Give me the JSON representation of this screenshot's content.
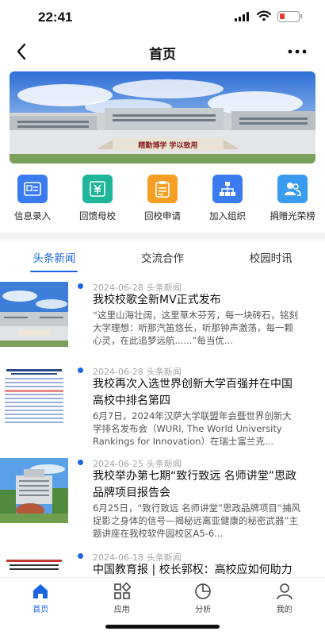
{
  "status_bar": {
    "time": "22:41"
  },
  "nav": {
    "title": "首页"
  },
  "banner": {
    "sign_text": "精勤博学 学以致用"
  },
  "actions": [
    {
      "label": "信息录入",
      "icon": "id-card-icon",
      "color": "#3a7cf0"
    },
    {
      "label": "回馈母校",
      "icon": "yuan-icon",
      "color": "#1fb59a"
    },
    {
      "label": "回校申请",
      "icon": "clipboard-icon",
      "color": "#f5a024"
    },
    {
      "label": "加入组织",
      "icon": "org-chart-icon",
      "color": "#3a7cf0"
    },
    {
      "label": "捐赠光荣榜",
      "icon": "people-icon",
      "color": "#3a9cf0"
    }
  ],
  "tabs": [
    {
      "label": "头条新闻",
      "active": true
    },
    {
      "label": "交流合作",
      "active": false
    },
    {
      "label": "校园时讯",
      "active": false
    }
  ],
  "news": [
    {
      "date": "2024-06-28",
      "category": "头条新闻",
      "title": "我校校歌全新MV正式发布",
      "summary": "“这里山海壮阔，这里草木芬芳，每一块砖石，铭刻大学理想：听那汽笛悠长，听那钟声激荡，每一颗心灵，在此追梦远航......”每当优..."
    },
    {
      "date": "2024-06-28",
      "category": "头条新闻",
      "title": "我校再次入选世界创新大学百强并在中国高校中排名第四",
      "summary": "6月7日，2024年汉萨大学联盟年会暨世界创新大学排名发布会（WURI, The World University Rankings for Innovation）在瑞士富兰克..."
    },
    {
      "date": "2024-06-25",
      "category": "头条新闻",
      "title": "我校举办第七期“致行致远 名师讲堂”思政品牌项目报告会",
      "summary": "6月25日，“致行致远 名师讲堂”思政品牌项目“捕风捉影之身体的信号—揭秘远离亚健康的秘密武器”主题讲座在我校软件园校区A5-6..."
    },
    {
      "date": "2024-06-18",
      "category": "头条新闻",
      "title": "中国教育报 | 校长郭权：高校应如何助力新质生产力发展",
      "summary": ""
    }
  ],
  "bottom_tabs": [
    {
      "label": "首页",
      "icon": "home-icon",
      "active": true
    },
    {
      "label": "应用",
      "icon": "apps-grid-icon",
      "active": false
    },
    {
      "label": "分析",
      "icon": "pie-chart-icon",
      "active": false
    },
    {
      "label": "我的",
      "icon": "user-icon",
      "active": false
    }
  ],
  "colors": {
    "accent": "#1a66e0",
    "battery_low": "#e53935"
  }
}
